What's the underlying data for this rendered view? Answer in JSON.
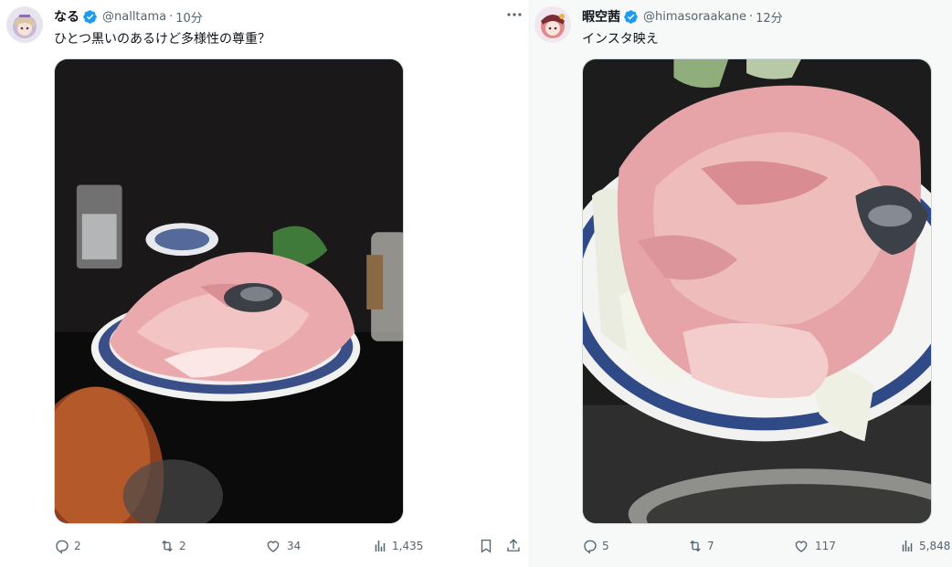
{
  "posts": [
    {
      "name": "なる",
      "handle": "@nalltama",
      "dot": "·",
      "time": "10分",
      "text": "ひとつ黒いのあるけど多様性の尊重？",
      "replies": "2",
      "reposts": "2",
      "likes": "34",
      "views": "1,435"
    },
    {
      "name": "暇空茜",
      "handle": "@himasoraakane",
      "dot": "·",
      "time": "12分",
      "text": "インスタ映え",
      "replies": "5",
      "reposts": "7",
      "likes": "117",
      "views": "5,848"
    }
  ],
  "colors": {
    "verified": "#1d9bf0",
    "secondary_text": "#536471",
    "divider": "#eff3f4"
  },
  "icons": [
    "more-icon",
    "reply-icon",
    "repost-icon",
    "like-icon",
    "views-icon",
    "bookmark-icon",
    "share-icon",
    "verified-badge-icon"
  ]
}
